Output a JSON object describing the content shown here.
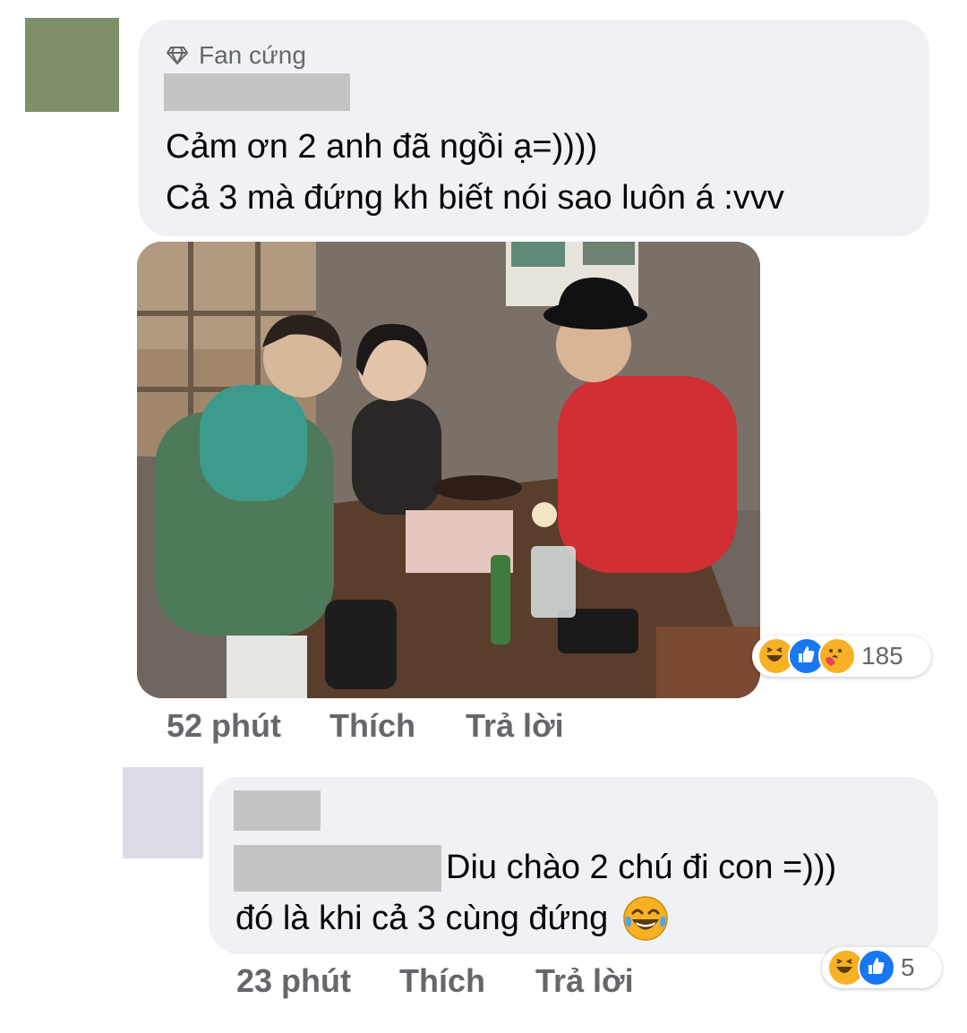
{
  "comment1": {
    "badge": "Fan cứng",
    "badge_icon": "diamond-icon",
    "line1": "Cảm ơn 2 anh đã ngồi ạ=))))",
    "line2": "Cả 3 mà đứng kh biết nói sao luôn á :vvv",
    "time": "52 phút",
    "like_label": "Thích",
    "reply_label": "Trả lời",
    "reactions": [
      "haha-icon",
      "like-icon",
      "care-icon"
    ],
    "reaction_count": "185",
    "avatar_color": "#7e8f6a"
  },
  "reply1": {
    "line1": "Diu chào 2 chú đi con =)))",
    "line2": "đó là khi cả 3 cùng đứng",
    "emoji": "laughing-tears-emoji",
    "time": "23 phút",
    "like_label": "Thích",
    "reply_label": "Trả lời",
    "reactions": [
      "haha-icon",
      "like-icon"
    ],
    "reaction_count": "5",
    "avatar_color": "#dddde8"
  },
  "colors": {
    "bubble": "#eff1f5",
    "meta_text": "#65676b",
    "like_blue": "#1877f2",
    "haha_yellow": "#f7b125"
  }
}
